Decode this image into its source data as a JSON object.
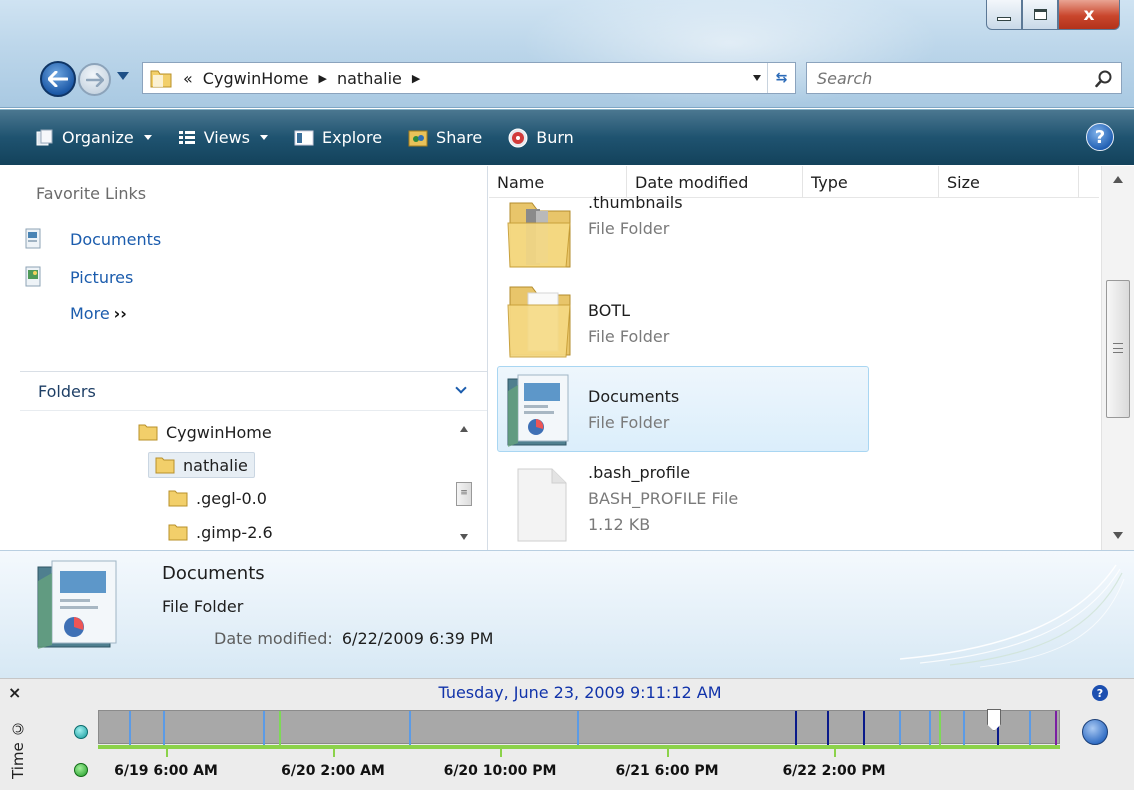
{
  "window": {
    "minimize_icon": "minimize-icon",
    "maximize_icon": "maximize-icon",
    "close_label": "x"
  },
  "address": {
    "overflow": "«",
    "crumbs": [
      "CygwinHome",
      "nathalie"
    ]
  },
  "search": {
    "placeholder": "Search"
  },
  "toolbar": {
    "organize": "Organize",
    "views": "Views",
    "explore": "Explore",
    "share": "Share",
    "burn": "Burn",
    "help": "?"
  },
  "favorites": {
    "header": "Favorite Links",
    "items": [
      {
        "label": "Documents",
        "icon": "documents-icon"
      },
      {
        "label": "Pictures",
        "icon": "pictures-icon"
      }
    ],
    "more": "More",
    "more_arrows": "››"
  },
  "folders": {
    "header": "Folders",
    "tree": [
      "CygwinHome",
      "nathalie",
      ".gegl-0.0",
      ".gimp-2.6"
    ]
  },
  "columns": [
    "Name",
    "Date modified",
    "Type",
    "Size"
  ],
  "files": [
    {
      "name": ".thumbnails",
      "type": "File Folder",
      "size": ""
    },
    {
      "name": "BOTL",
      "type": "File Folder",
      "size": ""
    },
    {
      "name": "Documents",
      "type": "File Folder",
      "size": ""
    },
    {
      "name": ".bash_profile",
      "type": "BASH_PROFILE File",
      "size": "1.12 KB"
    }
  ],
  "details": {
    "name": "Documents",
    "type": "File Folder",
    "date_label": "Date modified:",
    "date_value": "6/22/2009 6:39 PM"
  },
  "timeline": {
    "close": "×",
    "side_label": "Time ©",
    "current_datetime": "Tuesday, June 23, 2009 9:11:12 AM",
    "help": "?",
    "ticks": [
      "6/19 6:00 AM",
      "6/20 2:00 AM",
      "6/20 10:00 PM",
      "6/21 6:00 PM",
      "6/22 2:00 PM"
    ],
    "colors": {
      "track": "#a8a8a8",
      "baseline": "#8bd24a",
      "light_mark": "#5b9be6",
      "dark_mark": "#0a1a8a",
      "green_mark": "#7ed957"
    }
  }
}
